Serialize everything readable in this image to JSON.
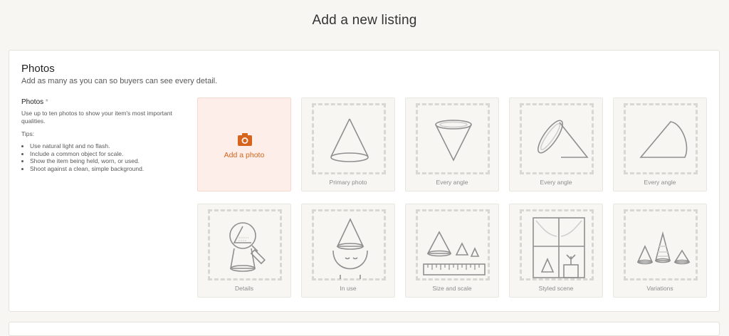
{
  "page": {
    "title": "Add a new listing"
  },
  "photos_section": {
    "title": "Photos",
    "subtitle": "Add as many as you can so buyers can see every detail.",
    "field_label": "Photos",
    "required_mark": "*",
    "description": "Use up to ten photos to show your item's most important qualities.",
    "tips_title": "Tips:",
    "tips": [
      "Use natural light and no flash.",
      "Include a common object for scale.",
      "Show the item being held, worn, or used.",
      "Shoot against a clean, simple background."
    ],
    "add_photo_label": "Add a photo",
    "add_icon": "camera-icon",
    "slots": [
      {
        "caption": "Primary photo",
        "icon": "cone-icon"
      },
      {
        "caption": "Every angle",
        "icon": "inverted-cone-icon"
      },
      {
        "caption": "Every angle",
        "icon": "tilted-cone-icon"
      },
      {
        "caption": "Every angle",
        "icon": "side-cone-icon"
      },
      {
        "caption": "Details",
        "icon": "magnifier-cone-icon"
      },
      {
        "caption": "In use",
        "icon": "cone-hat-face-icon"
      },
      {
        "caption": "Size and scale",
        "icon": "ruler-cones-icon"
      },
      {
        "caption": "Styled scene",
        "icon": "window-scene-icon"
      },
      {
        "caption": "Variations",
        "icon": "cone-variations-icon"
      }
    ]
  },
  "colors": {
    "accent": "#d5641c",
    "add_tile_bg": "#fdeee9",
    "tile_bg": "#f7f6f3",
    "illustration": "#8f8f8f",
    "page_bg": "#f7f6f3"
  }
}
